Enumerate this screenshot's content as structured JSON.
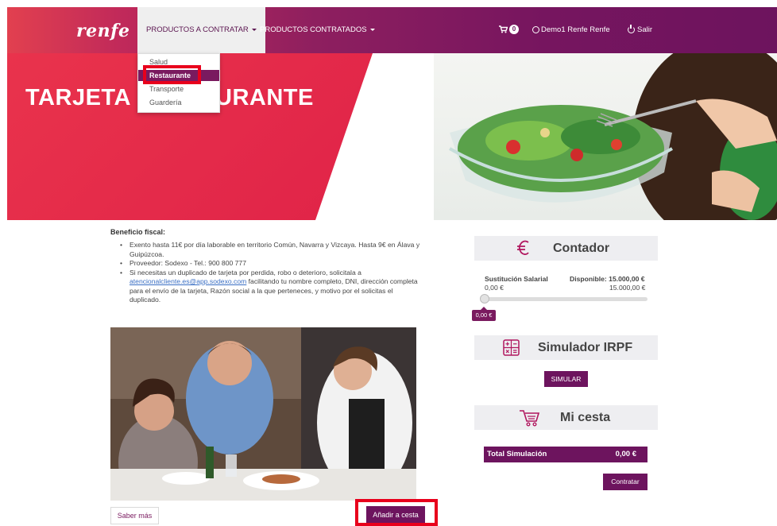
{
  "header": {
    "logo_text": "renfe",
    "menu": [
      {
        "label": "PRODUCTOS A CONTRATAR"
      },
      {
        "label": "PRODUCTOS CONTRATADOS"
      }
    ],
    "cart_count": "0",
    "user_name": "Demo1 Renfe Renfe",
    "logout_label": "Salir"
  },
  "dropdown": {
    "items": [
      "Salud",
      "Restaurante",
      "Transporte",
      "Guardería"
    ],
    "selected": "Restaurante"
  },
  "hero": {
    "title": "TARJETA RESTAURANTE"
  },
  "benefit": {
    "title": "Beneficio fiscal:",
    "items": [
      "Exento hasta 11€ por día laborable en territorio Común, Navarra y Vizcaya. Hasta 9€ en Álava y Guipúzcoa.",
      "Proveedor: Sodexo - Tel.: 900 800 777"
    ],
    "duplicate_pre": "Si necesitas un duplicado de tarjeta por perdida, robo o deterioro, solicitala a ",
    "duplicate_email": "atencionalcliente.es@app.sodexo.com",
    "duplicate_post": " facilitando tu nombre completo, DNI, dirección completa para el envío de la tarjeta, Razón social a la que perteneces, y motivo por el solicitas el duplicado."
  },
  "buttons": {
    "saber_mas": "Saber más",
    "anadir_cesta": "Añadir a cesta",
    "simular": "SIMULAR",
    "contratar": "Contratar"
  },
  "contador": {
    "icon": "euro-icon",
    "title": "Contador",
    "left_label": "Sustitución Salarial",
    "left_value": "0,00 €",
    "right_label": "Disponible: 15.000,00 €",
    "right_value": "15.000,00 €",
    "slider_value": "0,00 €",
    "slider_fraction": 0
  },
  "simulador": {
    "icon": "calculator-icon",
    "title": "Simulador IRPF"
  },
  "cesta": {
    "icon": "cart-icon",
    "title": "Mi cesta",
    "total_label": "Total Simulación",
    "total_value": "0,00 €"
  },
  "colors": {
    "brand_purple": "#6d145e",
    "brand_red": "#e2284a",
    "highlight_red": "#e8001c"
  }
}
